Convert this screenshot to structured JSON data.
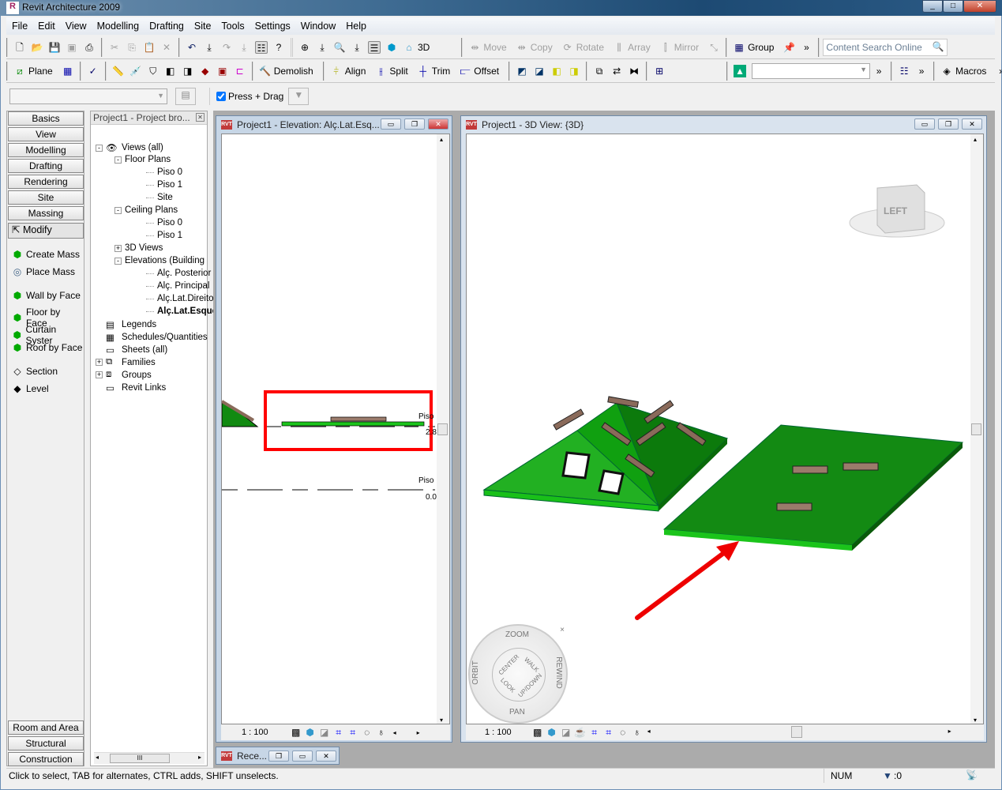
{
  "app": {
    "title": "Revit Architecture 2009"
  },
  "menu": [
    "File",
    "Edit",
    "View",
    "Modelling",
    "Drafting",
    "Site",
    "Tools",
    "Settings",
    "Window",
    "Help"
  ],
  "toolbar1": {
    "view_3d": "3D",
    "move": "Move",
    "copy": "Copy",
    "rotate": "Rotate",
    "array": "Array",
    "mirror": "Mirror",
    "group": "Group",
    "search_placeholder": "Content Search Online"
  },
  "toolbar2": {
    "plane": "Plane",
    "demolish": "Demolish",
    "align": "Align",
    "split": "Split",
    "trim": "Trim",
    "offset": "Offset",
    "macros": "Macros"
  },
  "options": {
    "press_drag": "Press + Drag",
    "press_drag_checked": true
  },
  "designbar": {
    "tabs": [
      "Basics",
      "View",
      "Modelling",
      "Drafting",
      "Rendering",
      "Site",
      "Massing"
    ],
    "modify": "Modify",
    "items": [
      "Create Mass",
      "Place Mass",
      "Wall by Face",
      "Floor by Face",
      "Curtain Syster",
      "Roof by Face",
      "Section",
      "Level"
    ],
    "bottom_tabs": [
      "Room and Area",
      "Structural",
      "Construction"
    ]
  },
  "browser": {
    "title": "Project1 - Project bro...",
    "scroll_thumb": "III",
    "tree": [
      {
        "label": "Views (all)",
        "depth": 0,
        "toggle": "-"
      },
      {
        "label": "Floor Plans",
        "depth": 1,
        "toggle": "-"
      },
      {
        "label": "Piso 0",
        "depth": 2
      },
      {
        "label": "Piso 1",
        "depth": 2
      },
      {
        "label": "Site",
        "depth": 2
      },
      {
        "label": "Ceiling Plans",
        "depth": 1,
        "toggle": "-"
      },
      {
        "label": "Piso 0",
        "depth": 2
      },
      {
        "label": "Piso 1",
        "depth": 2
      },
      {
        "label": "3D Views",
        "depth": 1,
        "toggle": "+"
      },
      {
        "label": "Elevations (Building",
        "depth": 1,
        "toggle": "-"
      },
      {
        "label": "Alç. Posterior",
        "depth": 2
      },
      {
        "label": "Alç. Principal",
        "depth": 2
      },
      {
        "label": "Alç.Lat.Direito",
        "depth": 2
      },
      {
        "label": "Alç.Lat.Esquerdo",
        "depth": 2,
        "bold": true
      },
      {
        "label": "Legends",
        "depth": 0
      },
      {
        "label": "Schedules/Quantities",
        "depth": 0
      },
      {
        "label": "Sheets (all)",
        "depth": 0
      },
      {
        "label": "Families",
        "depth": 0,
        "toggle": "+"
      },
      {
        "label": "Groups",
        "depth": 0,
        "toggle": "+"
      },
      {
        "label": "Revit Links",
        "depth": 0
      }
    ]
  },
  "elevation_view": {
    "title": "Project1 - Elevation: Alç.Lat.Esq...",
    "level1": "Piso",
    "level1_value": "2.8",
    "level0": "Piso",
    "level0_value": "0.0",
    "scale": "1 : 100"
  },
  "view3d": {
    "title": "Project1 - 3D View: {3D}",
    "viewcube": "LEFT",
    "scale": "1 : 100",
    "wheel": {
      "zoom": "ZOOM",
      "orbit": "ORBIT",
      "rewind": "REWIND",
      "pan": "PAN",
      "center": "CENTER",
      "walk": "WALK",
      "look": "LOOK",
      "updown": "UP/DOWN"
    }
  },
  "minimized": {
    "title": "Rece..."
  },
  "statusbar": {
    "message": "Click to select, TAB for alternates, CTRL adds, SHIFT unselects.",
    "num": "NUM",
    "filter": ":0"
  },
  "colors": {
    "highlight": "#ff0000",
    "roof_green": "#1f8f1f",
    "floor_green": "#138a13"
  }
}
